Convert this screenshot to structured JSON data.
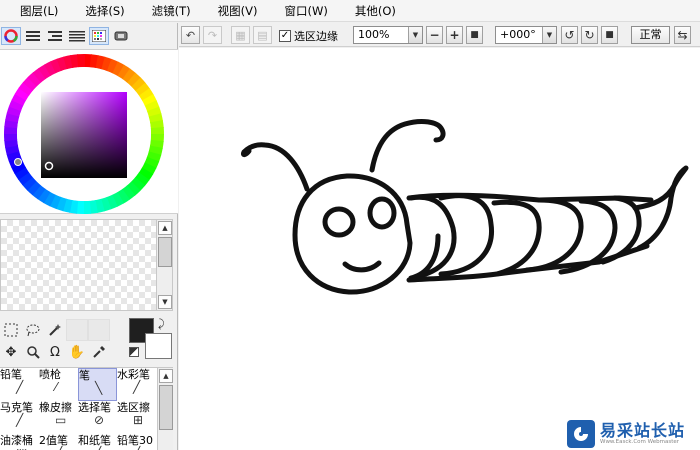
{
  "menu": {
    "items": [
      "图层(L)",
      "选择(S)",
      "滤镜(T)",
      "视图(V)",
      "窗口(W)",
      "其他(O)"
    ]
  },
  "toolbar": {
    "selection_edge_label": "选区边缘",
    "selection_edge_checked": true,
    "zoom_value": "100%",
    "rotation_value": "+000°",
    "blend_mode_label": "正常"
  },
  "color": {
    "foreground": "#1f1f1f",
    "background": "#ffffff",
    "tabs": [
      "color-wheel-icon",
      "rgb-sliders-icon",
      "hsv-sliders-icon",
      "color-history-icon",
      "color-palette-icon",
      "user-swatches-icon"
    ]
  },
  "tools": {
    "row1": [
      "rect-select-icon",
      "lasso-icon",
      "magic-wand-icon"
    ],
    "row2": [
      "move-icon",
      "zoom-icon",
      "rotate-icon",
      "hand-icon",
      "eyedropper-icon"
    ]
  },
  "brushes": [
    {
      "name": "铅笔",
      "icon": "pencil-icon",
      "selected": false
    },
    {
      "name": "喷枪",
      "icon": "airbrush-icon",
      "selected": false
    },
    {
      "name": "笔",
      "icon": "pen-icon",
      "selected": true
    },
    {
      "name": "水彩笔",
      "icon": "watercolor-icon",
      "selected": false
    },
    {
      "name": "马克笔",
      "icon": "marker-icon",
      "selected": false
    },
    {
      "name": "橡皮擦",
      "icon": "eraser-icon",
      "selected": false
    },
    {
      "name": "选择笔",
      "icon": "select-pen-icon",
      "selected": false
    },
    {
      "name": "选区擦",
      "icon": "select-eraser-icon",
      "selected": false
    },
    {
      "name": "油漆桶",
      "icon": "bucket-icon",
      "selected": false
    },
    {
      "name": "2值笔",
      "icon": "binary-pen-icon",
      "selected": false
    },
    {
      "name": "和纸笔",
      "icon": "washi-pen-icon",
      "selected": false
    },
    {
      "name": "铅笔30",
      "icon": "pencil30-icon",
      "selected": false
    }
  ],
  "watermark": {
    "title": "易采站长站",
    "url": "Www.Easck.Com Webmaster"
  }
}
